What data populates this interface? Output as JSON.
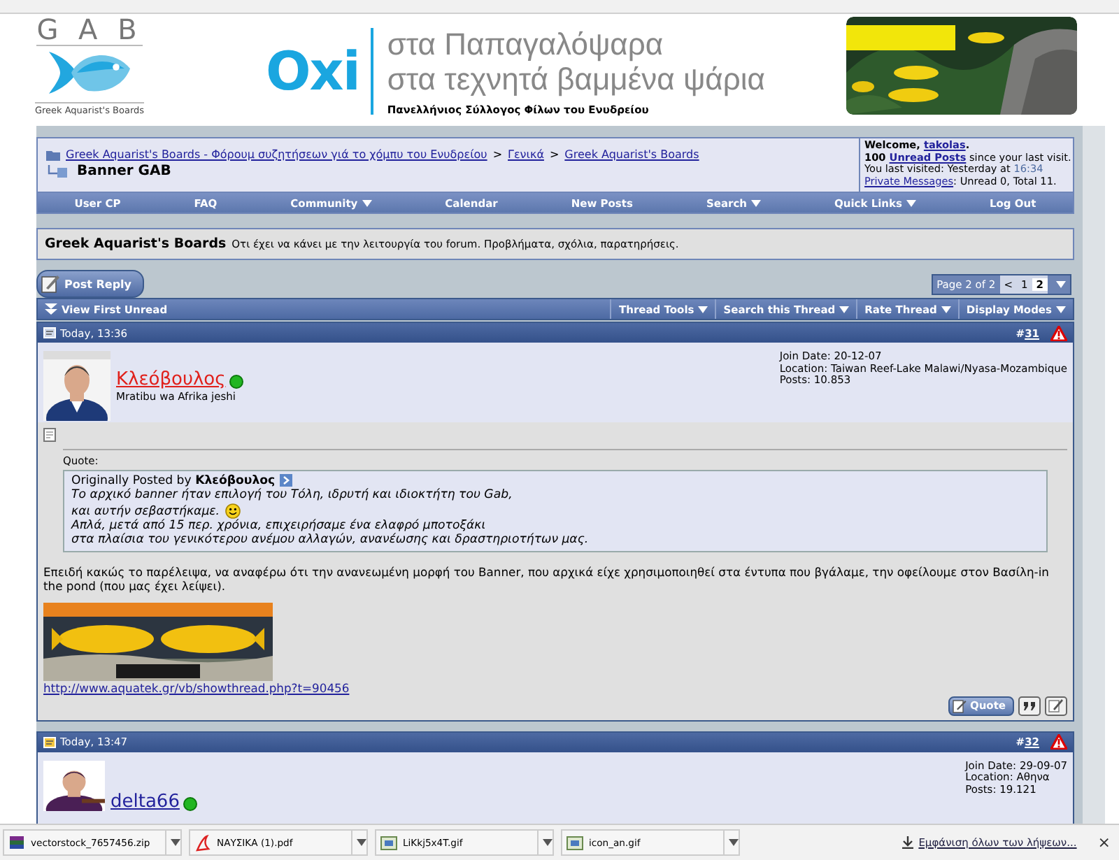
{
  "header": {
    "logo": {
      "letters": "G A B",
      "caption": "Greek Aquarist's Boards"
    },
    "slogan": {
      "mark": "Oxi",
      "lines": [
        "στα Παπαγαλόψαρα",
        "στα τεχνητά βαμμένα ψάρια"
      ],
      "subtitle": "Πανελλήνιος Σύλλογος Φίλων του Ενυδρείου"
    }
  },
  "breadcrumb": {
    "links": [
      "Greek Aquarist's Boards - Φόρουμ συζητήσεων γιά το χόμπυ του Ενυδρείου",
      "Γενικά",
      "Greek Aquarist's Boards"
    ],
    "separators": [
      ">",
      ">"
    ],
    "current": "Banner GAB"
  },
  "welcome": {
    "lines": [
      [
        {
          "kind": "bold",
          "text": "Welcome, "
        },
        {
          "kind": "bold_link",
          "text": "takolas"
        },
        {
          "kind": "bold",
          "text": "."
        }
      ],
      [
        {
          "kind": "bold",
          "text": "100 "
        },
        {
          "kind": "bold_link",
          "text": "Unread Posts"
        },
        {
          "kind": "text",
          "text": " since your last visit."
        }
      ],
      [
        {
          "kind": "text",
          "text": "You last visited: Yesterday at "
        },
        {
          "kind": "time",
          "text": "16:34"
        }
      ],
      [
        {
          "kind": "link",
          "text": "Private Messages"
        },
        {
          "kind": "text",
          "text": ": Unread 0, Total 11."
        }
      ]
    ]
  },
  "nav": [
    {
      "label": "User CP",
      "dropdown": false
    },
    {
      "label": "FAQ",
      "dropdown": false
    },
    {
      "label": "Community",
      "dropdown": true
    },
    {
      "label": "Calendar",
      "dropdown": false
    },
    {
      "label": "New Posts",
      "dropdown": false
    },
    {
      "label": "Search",
      "dropdown": true
    },
    {
      "label": "Quick Links",
      "dropdown": true
    },
    {
      "label": "Log Out",
      "dropdown": false
    }
  ],
  "forum": {
    "title": "Greek Aquarist's Boards",
    "description": "Οτι έχει να κάνει με την λειτουργία του forum. Προβλήματα, σχόλια, παρατηρήσεις."
  },
  "post_reply": "Post Reply",
  "pagination": {
    "summary": "Page 2 of 2",
    "prev": "<",
    "pages": [
      {
        "label": "1",
        "selected": false
      },
      {
        "label": "2",
        "selected": true
      }
    ]
  },
  "thread_bar": {
    "first_unread": "View First Unread",
    "tools": [
      "Thread Tools",
      "Search this Thread",
      "Rate Thread",
      "Display Modes"
    ]
  },
  "posts": [
    {
      "date": "Today, 13:36",
      "number_prefix": "#",
      "number": "31",
      "author": {
        "name": "Κλεόβουλος",
        "color": "#e0201b",
        "online": true,
        "title": "Mratibu wa Afrika jeshi"
      },
      "info": [
        "Join Date: 20-12-07",
        "Location: Taiwan Reef-Lake Malawi/Nyasa-Mozambique",
        "Posts: 10.853"
      ],
      "body": {
        "quote": {
          "label": "Quote:",
          "posted_by": "Originally Posted by",
          "author": "Κλεόβουλος",
          "lines": [
            {
              "text": "Το αρχικό banner ήταν επιλογή του Τόλη, ιδρυτή και ιδιοκτήτη του Gab,",
              "smiley": false
            },
            {
              "text": "και αυτήν σεβαστήκαμε.",
              "smiley": true
            },
            {
              "text": "Απλά, μετά από 15 περ. χρόνια, επιχειρήσαμε ένα ελαφρό μποτοξάκι",
              "smiley": false
            },
            {
              "text": "στα πλαίσια του γενικότερου ανέμου αλλαγών, ανανέωσης και δραστηριοτήτων μας.",
              "smiley": false
            }
          ]
        },
        "text": "Επειδή κακώς το παρέλειψα, να αναφέρω ότι την ανανεωμένη μορφή του Banner, που αρχικά είχε χρησιμοποιηθεί στα έντυπα που βγάλαμε, την οφείλουμε στον Βασίλη-in the pond (που μας έχει λείψει).",
        "link": "http://www.aquatek.gr/vb/showthread.php?t=90456",
        "actions": [
          {
            "kind": "quote",
            "label": "Quote"
          },
          {
            "kind": "multiquote"
          },
          {
            "kind": "quick_reply"
          }
        ]
      }
    },
    {
      "date": "Today, 13:47",
      "number_prefix": "#",
      "number": "32",
      "author": {
        "name": "delta66",
        "color": "#22229c",
        "online": true
      },
      "info": [
        "Join Date: 29-09-07",
        "Location: Αθηνα",
        "Posts: 19.121"
      ]
    }
  ],
  "downloads": {
    "items": [
      {
        "name": "vectorstock_7657456.zip",
        "kind": "zip"
      },
      {
        "name": "ΝΑΥΣΙΚΑ (1).pdf",
        "kind": "pdf"
      },
      {
        "name": "LiKkj5x4T.gif",
        "kind": "gif"
      },
      {
        "name": "icon_an.gif",
        "kind": "gif"
      }
    ],
    "show_all": "Εμφάνιση όλων των λήψεων...",
    "close": "×"
  }
}
